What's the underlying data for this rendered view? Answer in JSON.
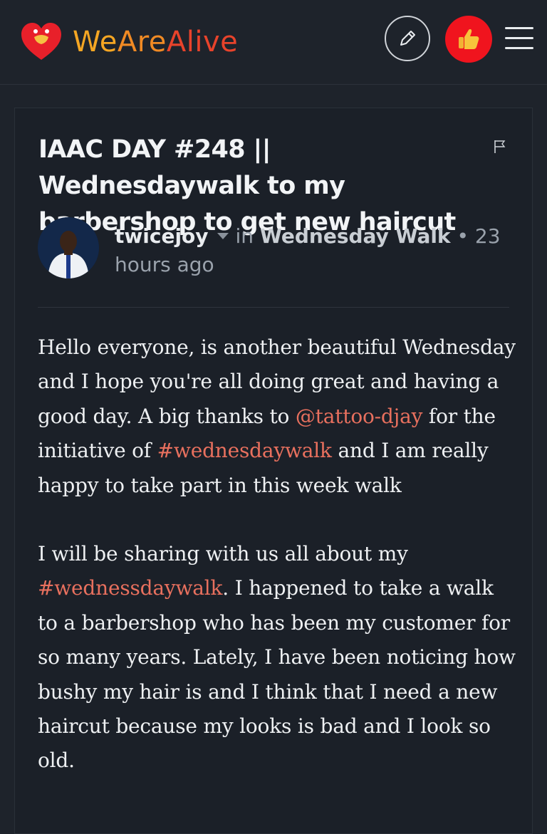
{
  "header": {
    "brand_we": "We",
    "brand_are": "Are",
    "brand_alive": "Alive",
    "icons": [
      "heart-logo",
      "pencil-icon",
      "thumbs-up-icon",
      "hamburger-menu-icon"
    ]
  },
  "post": {
    "title": "IAAC DAY #248 || Wednesdaywalk to my barbershop to get new haircut",
    "author": "twicejoy",
    "in_label": "in",
    "community": "Wednesday Walk",
    "time": "• 23 hours ago",
    "p1_a": "Hello everyone, is another beautiful Wednesday and I hope you're all doing great and having a good day. A big thanks to ",
    "p1_mention": "@tattoo-djay",
    "p1_b": " for the initiative of ",
    "p1_tag": "#wednesdaywalk",
    "p1_c": " and I am really happy to take part in this week walk",
    "p2_a": "I will be sharing with us all about my ",
    "p2_tag": "#wednessdaywalk",
    "p2_b": ". I happened to take a walk to a barbershop who has been my customer for so many years. Lately, I have been noticing how bushy my hair is and I think that I need a new haircut because my looks is bad and I look so old."
  },
  "colors": {
    "background": "#1e232b",
    "card": "#1b2028",
    "link": "#e8705e",
    "like_button": "#f0141e"
  }
}
